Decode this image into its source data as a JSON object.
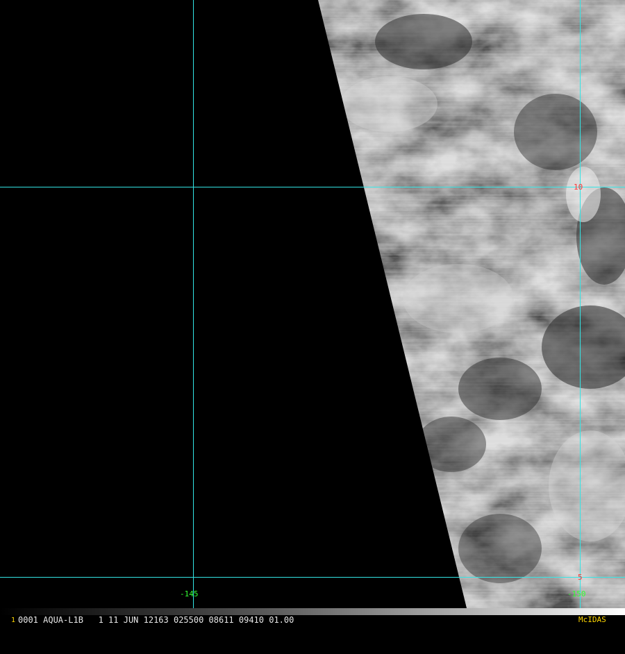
{
  "image": {
    "latitude_lines": [
      {
        "label": "10",
        "color": "#ff3333"
      },
      {
        "label": "5",
        "color": "#ff3333"
      }
    ],
    "longitude_lines": [
      {
        "label": "-145",
        "color": "#33ff33"
      },
      {
        "label": "-150",
        "color": "#33ff33"
      }
    ],
    "grid_color": "#33e5e5"
  },
  "status_bar": {
    "frame_number": "1",
    "text": "0001 AQUA-L1B   1 11 JUN 12163 025500 08611 09410 01.00",
    "brand": "McIDAS"
  }
}
